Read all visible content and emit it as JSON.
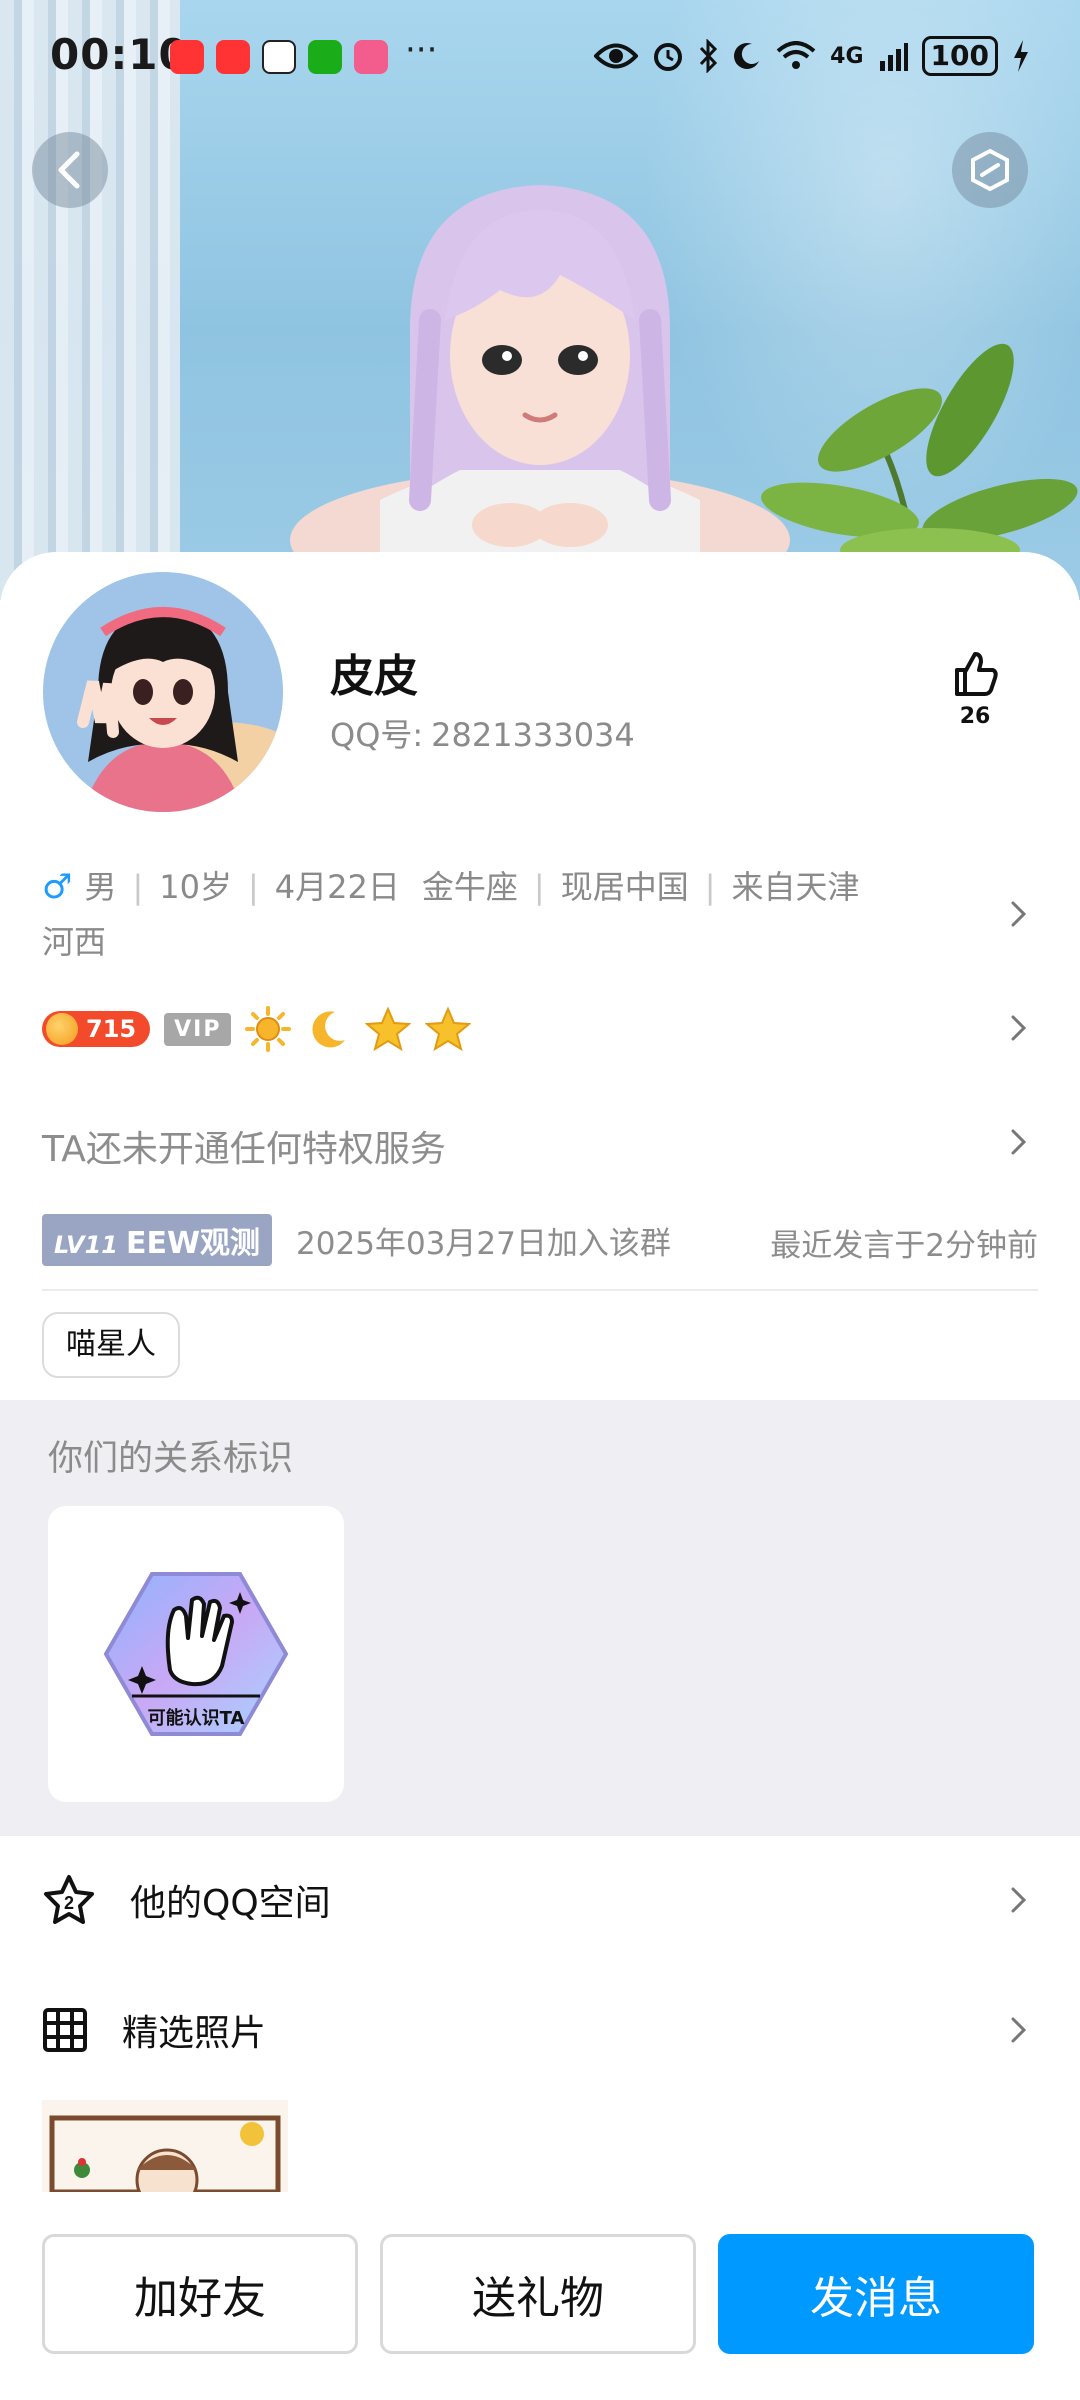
{
  "status_bar": {
    "time": "00:10",
    "more": "···",
    "network": "4G",
    "battery": "100",
    "icons": [
      "eye-icon",
      "alarm-icon",
      "bluetooth-icon",
      "moon-icon",
      "wifi-icon",
      "signal-icon",
      "charging-icon"
    ]
  },
  "profile": {
    "name": "皮皮",
    "qq_label": "QQ号:",
    "qq_number": "2821333034",
    "likes": "26",
    "gender": "男",
    "age": "10岁",
    "birthday": "4月22日",
    "zodiac": "金牛座",
    "residence": "现居中国",
    "hometown_line1": "来自天津",
    "hometown_line2": "河西"
  },
  "badges": {
    "coin_value": "715",
    "vip_label": "VIP"
  },
  "privilege_text": "TA还未开通任何特权服务",
  "group": {
    "level": "LV11",
    "title": "EEW观测",
    "joined": "2025年03月27日加入该群",
    "last_spoke": "最近发言于2分钟前"
  },
  "tag": "喵星人",
  "relation": {
    "title": "你们的关系标识",
    "badge_label": "可能认识TA"
  },
  "list": {
    "qzone": "他的QQ空间",
    "qzone_icon_text": "2",
    "photos": "精选照片"
  },
  "actions": {
    "add_friend": "加好友",
    "send_gift": "送礼物",
    "send_message": "发消息"
  },
  "colors": {
    "primary": "#0099ff",
    "gender_male": "#1e9bff",
    "coin": "#f24a2a",
    "level_badge": "#9aa5c4"
  }
}
